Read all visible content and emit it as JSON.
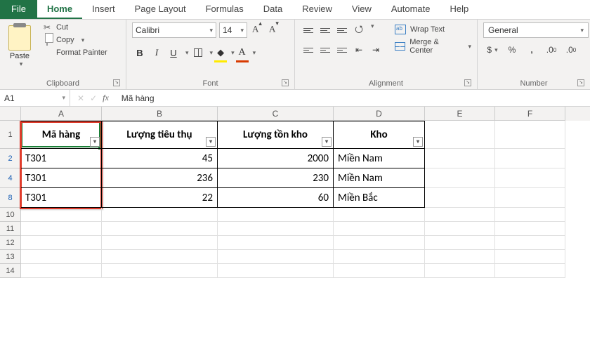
{
  "tabs": {
    "file": "File",
    "items": [
      "Home",
      "Insert",
      "Page Layout",
      "Formulas",
      "Data",
      "Review",
      "View",
      "Automate",
      "Help"
    ]
  },
  "ribbon": {
    "clipboard": {
      "paste": "Paste",
      "cut": "Cut",
      "copy": "Copy",
      "format_painter": "Format Painter",
      "title": "Clipboard"
    },
    "font": {
      "name": "Calibri",
      "size": "14",
      "b": "B",
      "i": "I",
      "u": "U",
      "title": "Font"
    },
    "alignment": {
      "wrap": "Wrap Text",
      "merge": "Merge & Center",
      "title": "Alignment"
    },
    "number": {
      "format": "General",
      "title": "Number"
    }
  },
  "formula_bar": {
    "name_box": "A1",
    "fx": "fx",
    "content": "Mã hàng"
  },
  "columns": [
    "A",
    "B",
    "C",
    "D",
    "E",
    "F"
  ],
  "headers": [
    "Mã hàng",
    "Lượng tiêu thụ",
    "Lượng tồn kho",
    "Kho"
  ],
  "visible_row_numbers": [
    "1",
    "2",
    "4",
    "8",
    "10",
    "11",
    "12",
    "13",
    "14"
  ],
  "rows": [
    {
      "n": "2",
      "a": "T301",
      "b": "45",
      "c": "2000",
      "d": "Miền Nam"
    },
    {
      "n": "4",
      "a": "T301",
      "b": "236",
      "c": "230",
      "d": "Miền Nam"
    },
    {
      "n": "8",
      "a": "T301",
      "b": "22",
      "c": "60",
      "d": "Miền Bắc"
    }
  ],
  "chart_data": {
    "type": "table",
    "title": "Filtered inventory list",
    "columns": [
      "Mã hàng",
      "Lượng tiêu thụ",
      "Lượng tồn kho",
      "Kho"
    ],
    "rows": [
      [
        "T301",
        45,
        2000,
        "Miền Nam"
      ],
      [
        "T301",
        236,
        230,
        "Miền Nam"
      ],
      [
        "T301",
        22,
        60,
        "Miền Bắc"
      ]
    ]
  }
}
